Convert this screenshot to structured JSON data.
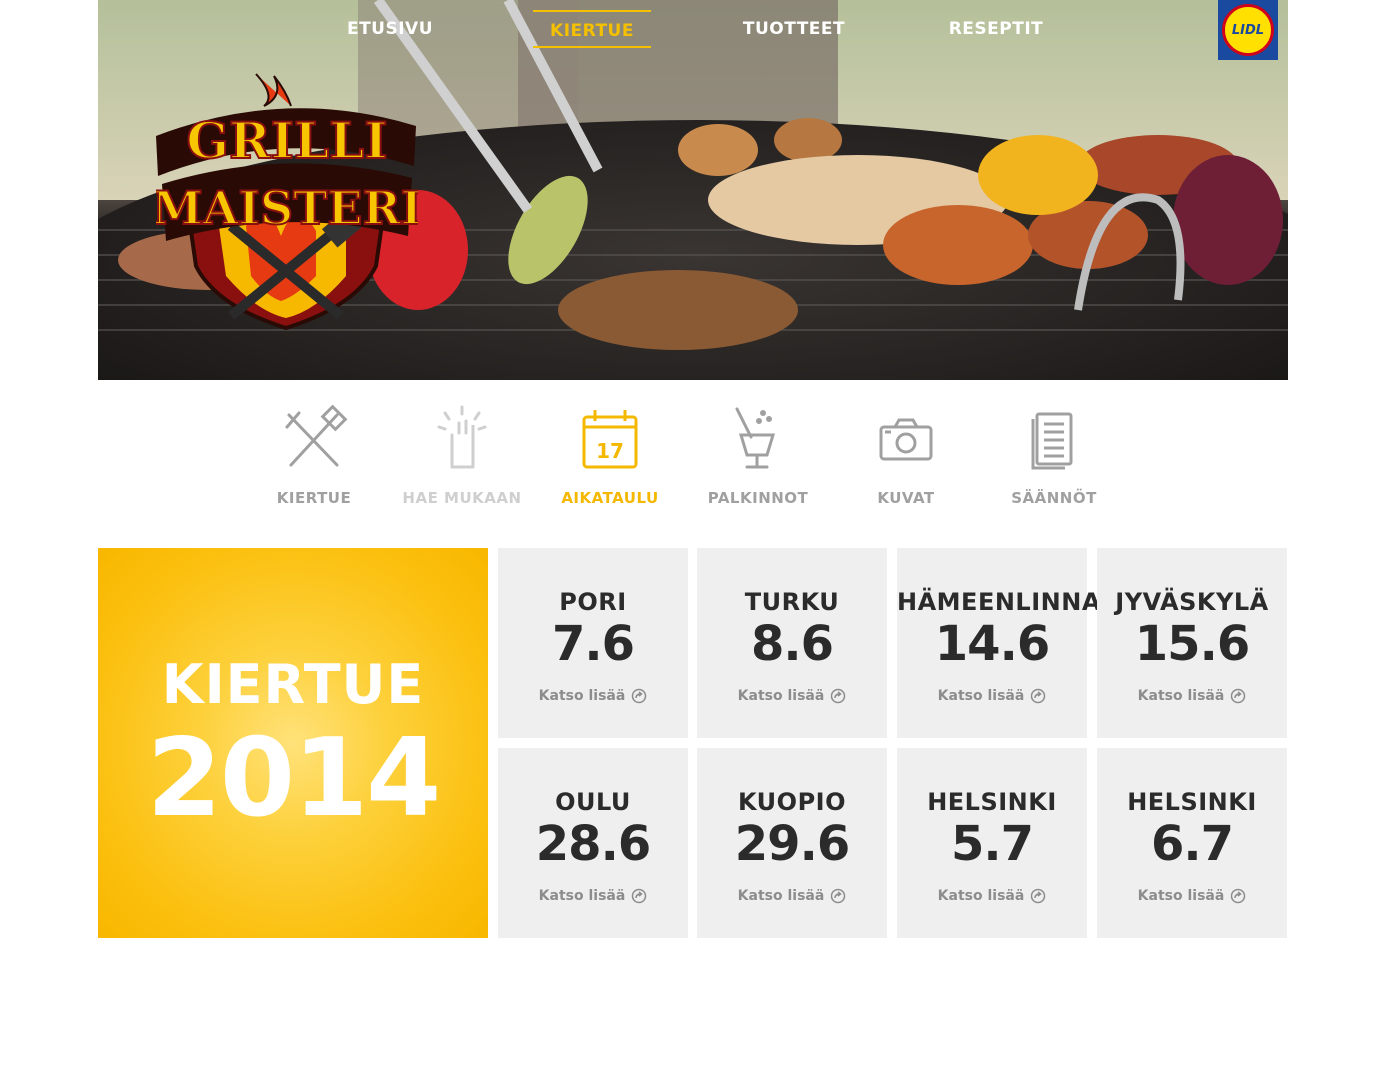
{
  "nav": {
    "items": [
      {
        "label": "ETUSIVU",
        "active": false
      },
      {
        "label": "KIERTUE",
        "active": true
      },
      {
        "label": "TUOTTEET",
        "active": false
      },
      {
        "label": "RESEPTIT",
        "active": false
      }
    ],
    "brand_logo": "LIDL"
  },
  "hero": {
    "logo_line1": "GRILLI",
    "logo_line2": "MAISTERI"
  },
  "icon_nav": [
    {
      "label": "KIERTUE",
      "icon": "grill-tools-icon",
      "state": "default"
    },
    {
      "label": "HAE MUKAAN",
      "icon": "raised-hand-icon",
      "state": "faded"
    },
    {
      "label": "AIKATAULU",
      "icon": "calendar-icon",
      "state": "active",
      "calendar_day": "17"
    },
    {
      "label": "PALKINNOT",
      "icon": "champagne-bucket-icon",
      "state": "default"
    },
    {
      "label": "KUVAT",
      "icon": "camera-icon",
      "state": "default"
    },
    {
      "label": "SÄÄNNÖT",
      "icon": "document-icon",
      "state": "default"
    }
  ],
  "tour": {
    "title": "KIERTUE",
    "year": "2014",
    "more_label": "Katso lisää",
    "stops": [
      {
        "city": "PORI",
        "date": "7.6"
      },
      {
        "city": "TURKU",
        "date": "8.6"
      },
      {
        "city": "HÄMEENLINNA",
        "date": "14.6"
      },
      {
        "city": "JYVÄSKYLÄ",
        "date": "15.6"
      },
      {
        "city": "OULU",
        "date": "28.6"
      },
      {
        "city": "KUOPIO",
        "date": "29.6"
      },
      {
        "city": "HELSINKI",
        "date": "5.7"
      },
      {
        "city": "HELSINKI",
        "date": "6.7"
      }
    ]
  },
  "colors": {
    "accent": "#f5b800",
    "tile_bg": "#efefef",
    "text_dark": "#2b2b2b",
    "icon_gray": "#a0a0a0"
  }
}
